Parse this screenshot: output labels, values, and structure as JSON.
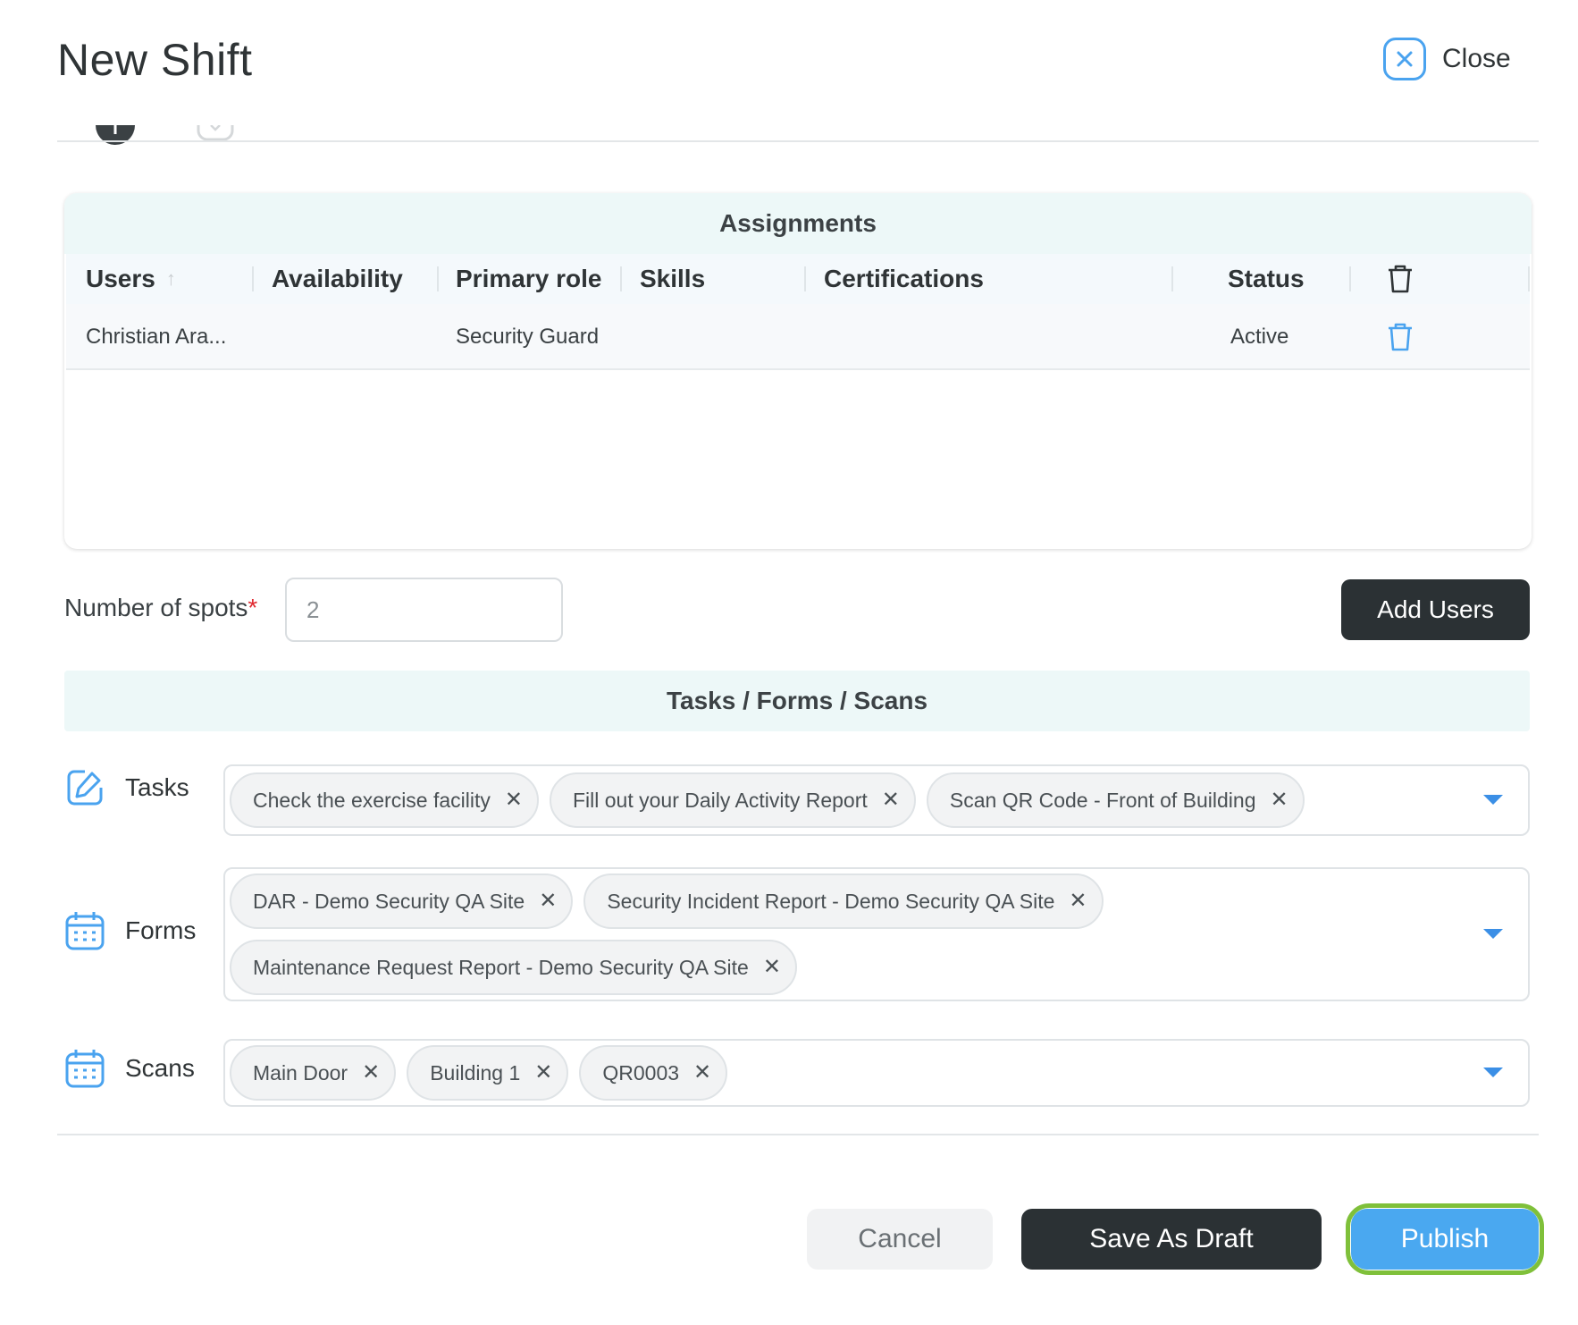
{
  "header": {
    "title": "New Shift",
    "close_label": "Close",
    "close_icon": "close-icon",
    "accent_color": "#4aa3ef"
  },
  "assignments": {
    "title": "Assignments",
    "columns": [
      "Users",
      "Availability",
      "Primary role",
      "Skills",
      "Certifications",
      "Status"
    ],
    "sort_column": "Users",
    "sort_direction": "ascending",
    "header_delete_icon": "trash-icon",
    "rows": [
      {
        "user": "Christian Ara...",
        "availability": "",
        "primary_role": "Security Guard",
        "skills": "",
        "certifications": "",
        "status": "Active",
        "delete_icon": "trash-icon"
      }
    ]
  },
  "spots": {
    "label": "Number of spots",
    "required_marker": "*",
    "value": "2"
  },
  "add_users_label": "Add Users",
  "tfs": {
    "title": "Tasks / Forms / Scans",
    "tasks": {
      "label": "Tasks",
      "icon": "edit-icon",
      "chips": [
        "Check the exercise facility",
        "Fill out your Daily Activity Report",
        "Scan QR Code - Front of Building"
      ]
    },
    "forms": {
      "label": "Forms",
      "icon": "calendar-icon",
      "chips": [
        "DAR - Demo Security QA Site",
        "Security Incident Report - Demo Security QA Site",
        "Maintenance Request Report - Demo Security QA Site"
      ]
    },
    "scans": {
      "label": "Scans",
      "icon": "calendar-icon",
      "chips": [
        "Main Door",
        "Building 1",
        "QR0003"
      ]
    }
  },
  "footer": {
    "cancel_label": "Cancel",
    "draft_label": "Save As Draft",
    "publish_label": "Publish",
    "publish_color": "#4aa8f0",
    "publish_focus_color": "#7fc03a"
  }
}
